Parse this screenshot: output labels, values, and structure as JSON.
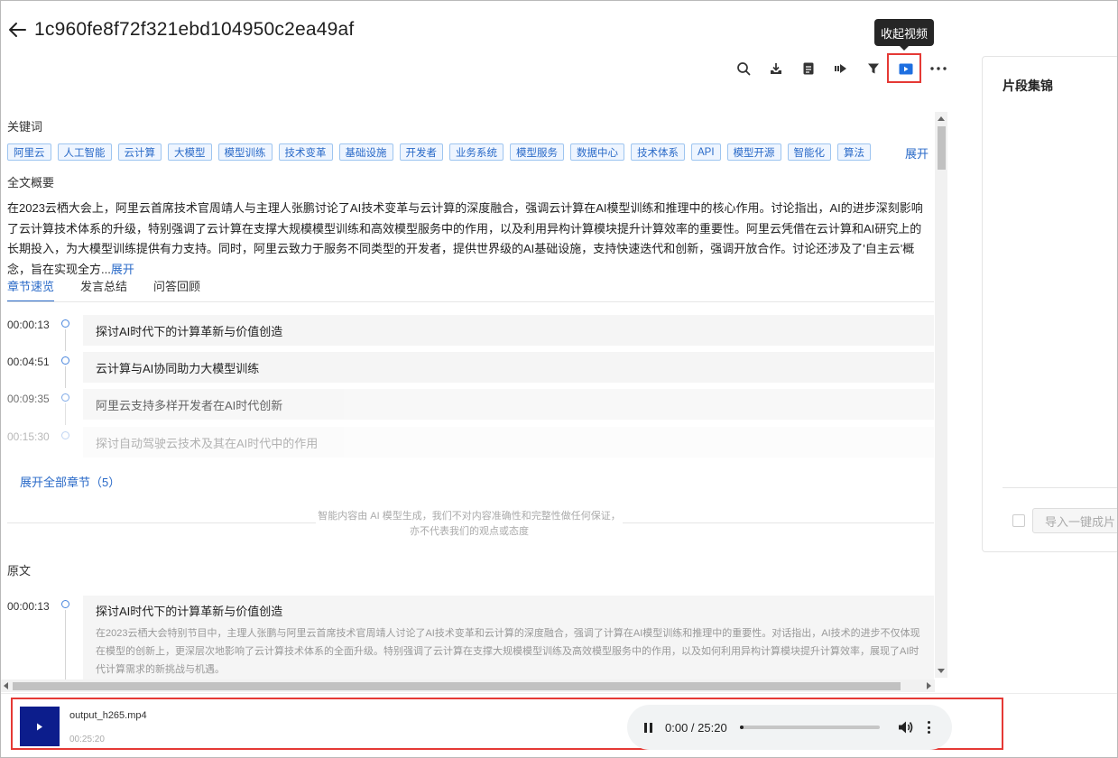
{
  "page": {
    "title": "1c960fe8f72f321ebd104950c2ea49af"
  },
  "tooltip": {
    "text": "收起视频"
  },
  "colors": {
    "accent": "#2a6ac8",
    "highlight": "#e53935",
    "video_thumb": "#0c1d8c"
  },
  "toolbar": {
    "icons": [
      "search-icon",
      "download-icon",
      "notes-icon",
      "export-icon",
      "filter-icon",
      "video-icon",
      "more-icon"
    ]
  },
  "keywords": {
    "label": "关键词",
    "items": [
      "阿里云",
      "人工智能",
      "云计算",
      "大模型",
      "模型训练",
      "技术变革",
      "基础设施",
      "开发者",
      "业务系统",
      "模型服务",
      "数据中心",
      "技术体系",
      "API",
      "模型开源",
      "智能化",
      "算法"
    ],
    "expand": "展开"
  },
  "summary": {
    "label": "全文概要",
    "text": "在2023云栖大会上，阿里云首席技术官周靖人与主理人张鹏讨论了AI技术变革与云计算的深度融合，强调云计算在AI模型训练和推理中的核心作用。讨论指出，AI的进步深刻影响了云计算技术体系的升级，特别强调了云计算在支撑大规模模型训练和高效模型服务中的作用，以及利用异构计算模块提升计算效率的重要性。阿里云凭借在云计算和AI研究上的长期投入，为大模型训练提供有力支持。同时，阿里云致力于服务不同类型的开发者，提供世界级的AI基础设施，支持快速迭代和创新，强调开放合作。讨论还涉及了'自主云'概念，旨在实现全方...",
    "more": "展开"
  },
  "tabs": [
    {
      "label": "章节速览",
      "active": true
    },
    {
      "label": "发言总结",
      "active": false
    },
    {
      "label": "问答回顾",
      "active": false
    }
  ],
  "chapters": [
    {
      "time": "00:00:13",
      "title": "探讨AI时代下的计算革新与价值创造"
    },
    {
      "time": "00:04:51",
      "title": "云计算与AI协同助力大模型训练"
    },
    {
      "time": "00:09:35",
      "title": "阿里云支持多样开发者在AI时代创新"
    },
    {
      "time": "00:15:30",
      "title": "探讨自动驾驶云技术及其在AI时代中的作用"
    }
  ],
  "expand_all": "展开全部章节（5）",
  "disclaimer": "智能内容由 AI 模型生成，我们不对内容准确性和完整性做任何保证，亦不代表我们的观点或态度",
  "original": {
    "label": "原文",
    "time": "00:00:13",
    "title": "探讨AI时代下的计算革新与价值创造",
    "text": "在2023云栖大会特别节目中，主理人张鹏与阿里云首席技术官周靖人讨论了AI技术变革和云计算的深度融合，强调了计算在AI模型训练和推理中的重要性。对话指出，AI技术的进步不仅体现在模型的创新上，更深层次地影响了云计算技术体系的全面升级。特别强调了云计算在支撑大规模模型训练及高效模型服务中的作用，以及如何利用异构计算模块提升计算效率，展现了AI时代计算需求的新挑战与机遇。"
  },
  "right_panel": {
    "title": "片段集锦",
    "import_button": "导入一键成片"
  },
  "player": {
    "filename": "output_h265.mp4",
    "duration": "00:25:20",
    "current_time": "0:00 / 25:20",
    "progress": 0.03
  }
}
